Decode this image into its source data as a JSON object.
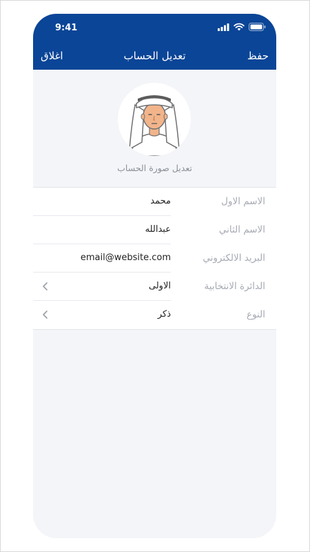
{
  "status_bar": {
    "time": "9:41"
  },
  "nav": {
    "close_label": "اغلاق",
    "title": "تعديل الحساب",
    "save_label": "حفظ"
  },
  "profile": {
    "edit_photo_label": "تعديل صورة الحساب"
  },
  "fields": [
    {
      "label": "الاسم الاول",
      "value": "محمد"
    },
    {
      "label": "الاسم الثاني",
      "value": "عبدالله"
    },
    {
      "label": "البريد الالكتروني",
      "value": "email@website.com"
    },
    {
      "label": "الدائرة الانتخابية",
      "value": "الاولى",
      "chevron": true
    },
    {
      "label": "النوع",
      "value": "ذكر",
      "chevron": true
    }
  ],
  "colors": {
    "header_bg": "#0a4597",
    "page_bg": "#f4f5f8",
    "label": "#a6aab2"
  },
  "icons": [
    "signal-icon",
    "wifi-icon",
    "battery-icon",
    "chevron-left-icon",
    "user-avatar-icon"
  ]
}
